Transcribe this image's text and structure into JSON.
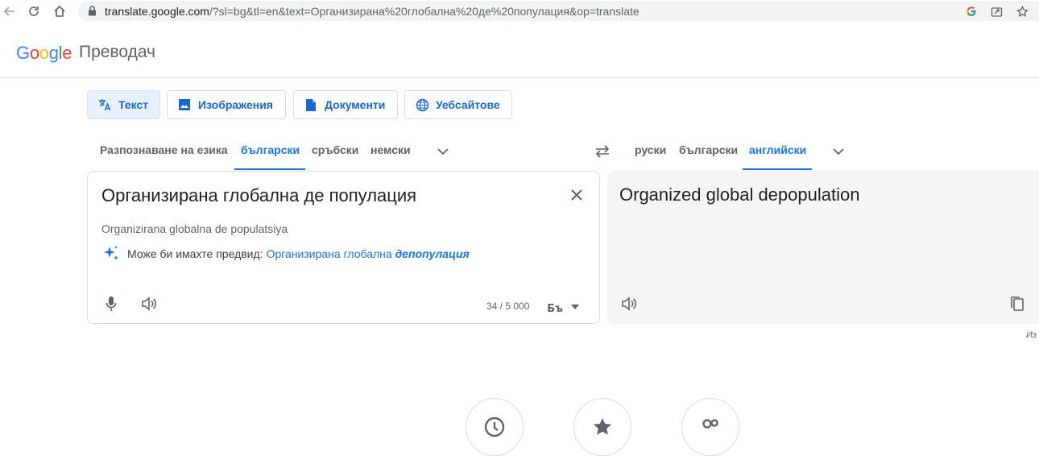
{
  "browser": {
    "url_host": "translate.google.com",
    "url_path": "/?sl=bg&tl=en&text=Организирана%20глобална%20де%20популация&op=translate"
  },
  "app": {
    "logo_letters": [
      "G",
      "o",
      "o",
      "g",
      "l",
      "e"
    ],
    "logo_colors": [
      "#4285f4",
      "#ea4335",
      "#fbbc05",
      "#4285f4",
      "#34a853",
      "#ea4335"
    ],
    "product_name": "Преводач"
  },
  "modes": [
    {
      "label": "Текст",
      "icon": "translate-icon",
      "active": true
    },
    {
      "label": "Изображения",
      "icon": "image-icon",
      "active": false
    },
    {
      "label": "Документи",
      "icon": "document-icon",
      "active": false
    },
    {
      "label": "Уебсайтове",
      "icon": "globe-icon",
      "active": false
    }
  ],
  "source_langs": {
    "detect": "Разпознаване на езика",
    "items": [
      "български",
      "сръбски",
      "немски"
    ],
    "active": "български"
  },
  "target_langs": {
    "items": [
      "руски",
      "български",
      "английски"
    ],
    "active": "английски"
  },
  "source": {
    "text": "Организирана глобална де популация",
    "transliteration": "Organizirana globalna de populatsiya",
    "suggest_prefix": "Може би имахте предвид:",
    "suggest_plain": "Организирана глобална",
    "suggest_bold": "депопулация",
    "char_count": "34 / 5 000"
  },
  "target": {
    "text": "Organized global depopulation"
  },
  "side_note": "Из",
  "colors": {
    "accent": "#1a73e8",
    "active_bg": "#e8f0fe",
    "target_bg": "#f5f5f5",
    "border": "#dadce0"
  }
}
